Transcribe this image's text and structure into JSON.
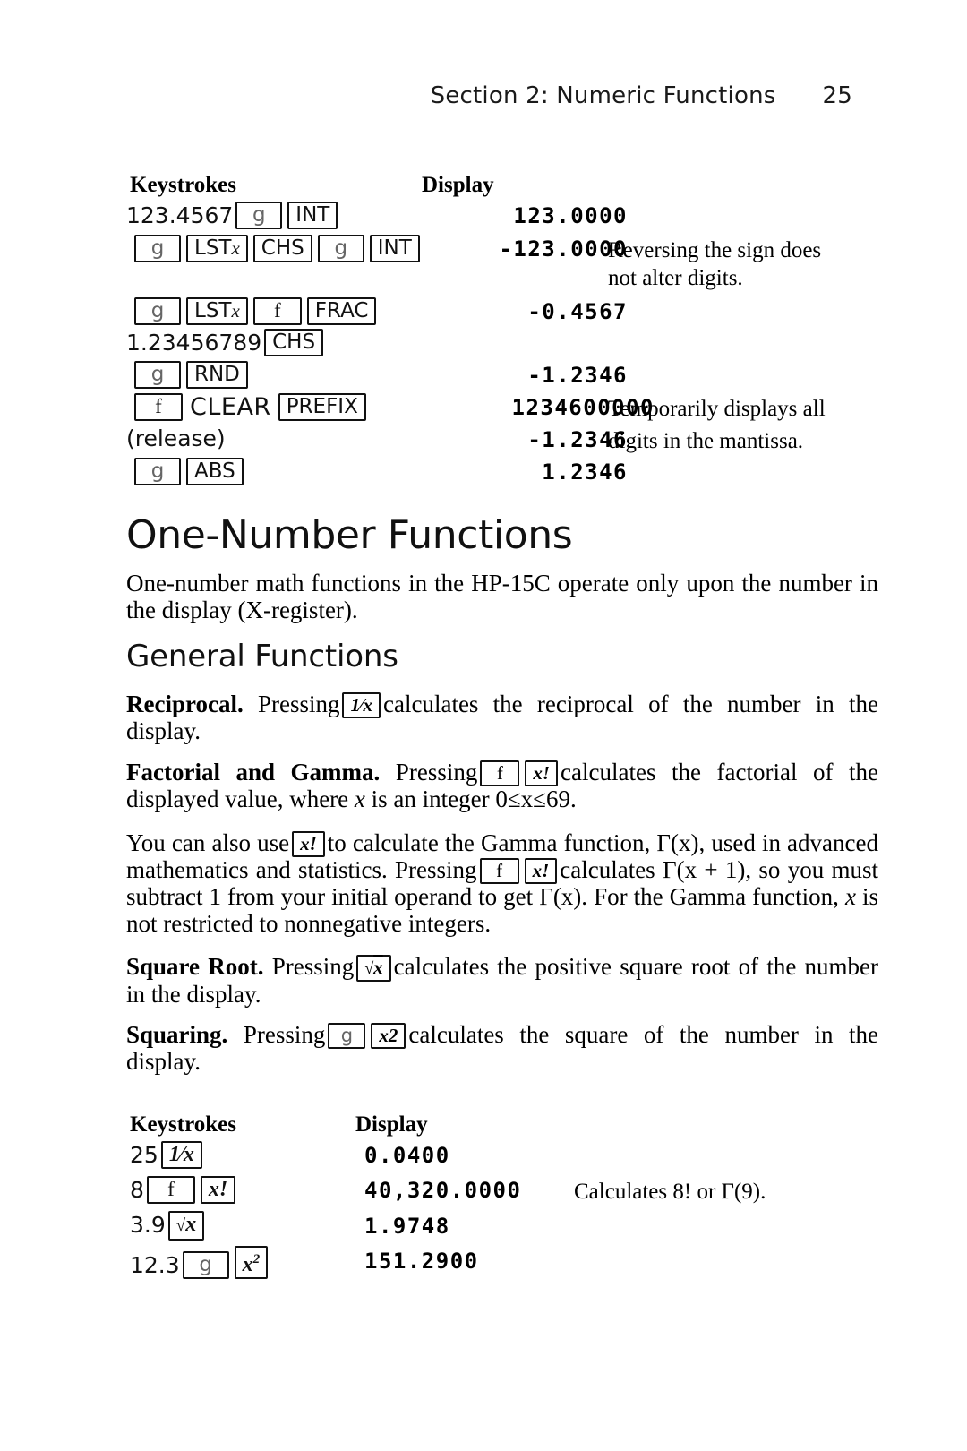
{
  "header": {
    "section": "Section 2: Numeric Functions",
    "page_number": "25"
  },
  "table_top": {
    "col_keystrokes": "Keystrokes",
    "col_display": "Display",
    "rows": [
      {
        "keys_prefix": "123.4567",
        "keys": [
          "g",
          "INT"
        ],
        "display": "123.0000",
        "note": ""
      },
      {
        "keys_prefix": "",
        "keys": [
          "g",
          "LSTx",
          "CHS",
          "g",
          "INT"
        ],
        "display": "-123.0000",
        "note": "Reversing the sign does"
      },
      {
        "keys_prefix": "",
        "keys": [],
        "display": "",
        "note": "not alter digits."
      },
      {
        "keys_prefix": "",
        "keys": [
          "g",
          "LSTx",
          "f",
          "FRAC"
        ],
        "display": "-0.4567",
        "note": ""
      },
      {
        "keys_prefix": "1.23456789",
        "keys": [
          "CHS"
        ],
        "display": "",
        "note": ""
      },
      {
        "keys_prefix": "",
        "keys": [
          "g",
          "RND"
        ],
        "display": "-1.2346",
        "note": ""
      },
      {
        "keys_prefix": "",
        "keys": [
          "f",
          "CLEAR",
          "PREFIX"
        ],
        "display": "1234600000",
        "note": "Temporarily displays all"
      },
      {
        "keys_prefix": "(release)",
        "keys": [],
        "display": "-1.2346",
        "note": "digits in the mantissa."
      },
      {
        "keys_prefix": "",
        "keys": [
          "g",
          "ABS"
        ],
        "display": "1.2346",
        "note": ""
      }
    ]
  },
  "section": {
    "title": "One-Number Functions",
    "intro": "One-number math functions in the HP-15C operate only upon the number in the display (X-register).",
    "subsection_title": "General Functions"
  },
  "paragraphs": {
    "reciprocal_label": "Reciprocal.",
    "reciprocal_a": "Pressing",
    "reciprocal_key": "1/x",
    "reciprocal_b": "calculates the reciprocal of the number in the display.",
    "factorial_label": "Factorial and Gamma.",
    "factorial_a": "Pressing",
    "factorial_key1": "f",
    "factorial_key2": "x!",
    "factorial_b": "calculates the factorial of the displayed value, where",
    "factorial_x": "x",
    "factorial_c": "is an integer 0≤x≤69.",
    "gamma_a": "You can also use",
    "gamma_key1": "x!",
    "gamma_b": "to calculate the Gamma function, Γ(x), used in advanced mathematics and statistics. Pressing",
    "gamma_key2": "f",
    "gamma_key3": "x!",
    "gamma_c": "calculates Γ(x + 1), so you must subtract 1 from your initial operand to get Γ(x). For the Gamma function,",
    "gamma_x": "x",
    "gamma_d": "is not restricted to nonnegative integers.",
    "sqrt_label": "Square Root.",
    "sqrt_a": "Pressing",
    "sqrt_key": "√x",
    "sqrt_b": "calculates the positive square root of the number in the display.",
    "squaring_label": "Squaring.",
    "squaring_a": "Pressing",
    "squaring_key1": "g",
    "squaring_key2": "x²",
    "squaring_b": "calculates the square of the number in the display."
  },
  "table_bottom": {
    "col_keystrokes": "Keystrokes",
    "col_display": "Display",
    "rows": [
      {
        "keys_prefix": "25",
        "keys": [
          "1/x"
        ],
        "display": "0.0400",
        "note": ""
      },
      {
        "keys_prefix": "8",
        "keys": [
          "f",
          "x!"
        ],
        "display": "40,320.0000",
        "note": "Calculates 8! or Γ(9)."
      },
      {
        "keys_prefix": "3.9",
        "keys": [
          "√x"
        ],
        "display": "1.9748",
        "note": ""
      },
      {
        "keys_prefix": "12.3",
        "keys": [
          "g",
          "x²"
        ],
        "display": "151.2900",
        "note": ""
      }
    ]
  }
}
